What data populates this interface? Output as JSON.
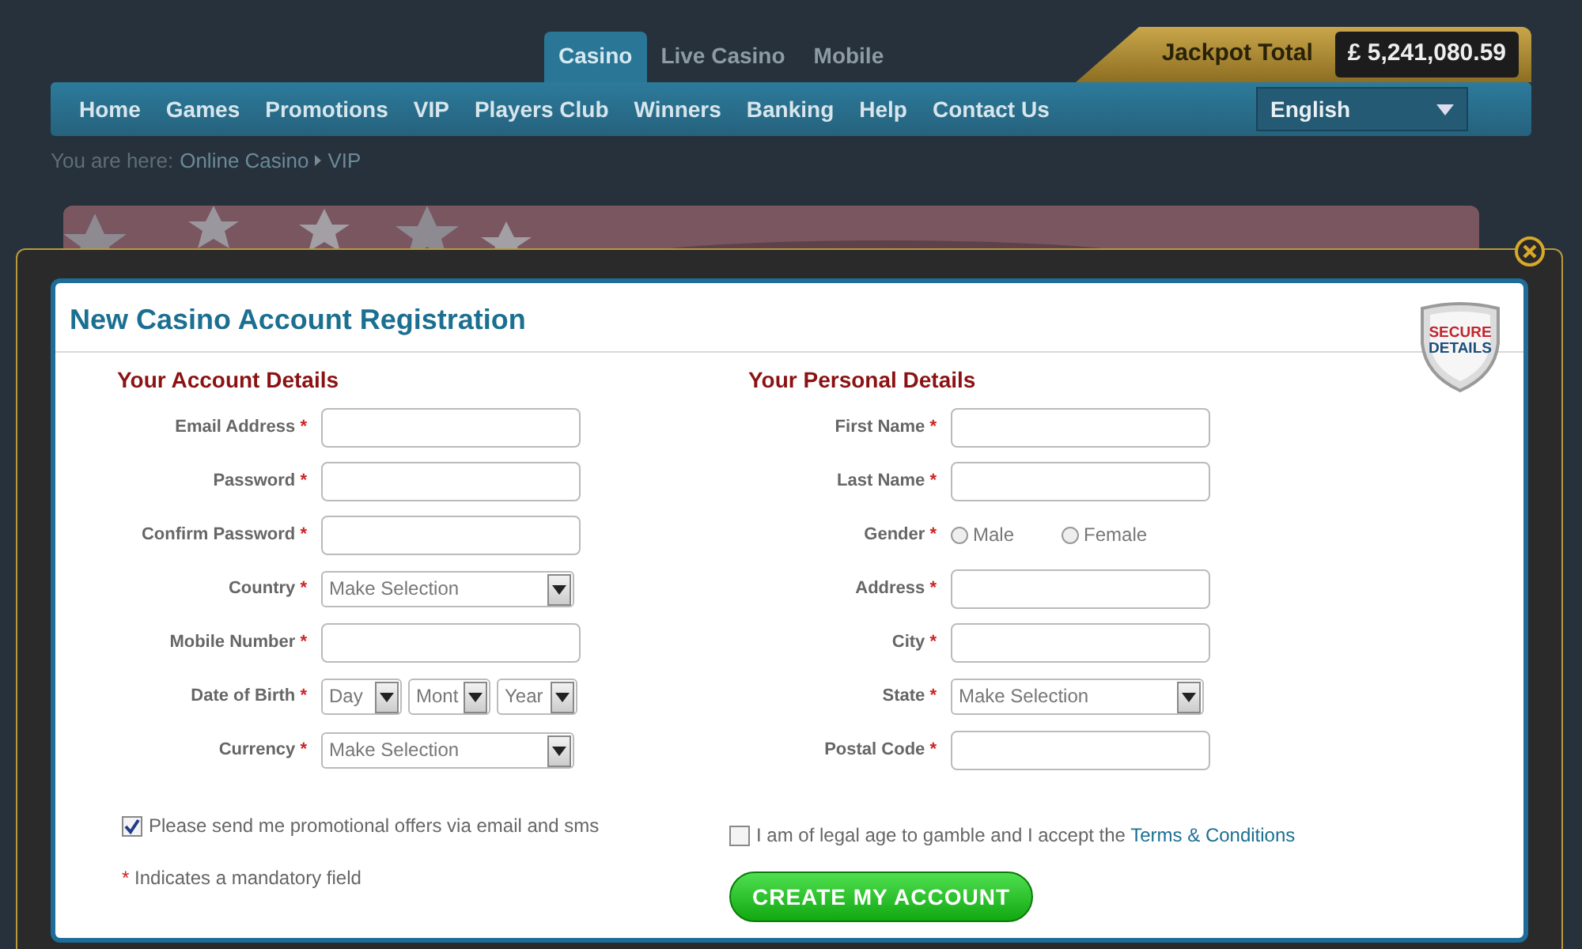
{
  "top_tabs": [
    {
      "label": "Casino",
      "selected": true
    },
    {
      "label": "Live Casino",
      "selected": false
    },
    {
      "label": "Mobile",
      "selected": false
    }
  ],
  "jackpot": {
    "label": "Jackpot Total",
    "amount": "£ 5,241,080.59"
  },
  "nav": {
    "items": [
      "Home",
      "Games",
      "Promotions",
      "VIP",
      "Players Club",
      "Winners",
      "Banking",
      "Help",
      "Contact Us"
    ],
    "language": "English"
  },
  "breadcrumb": {
    "prefix": "You are here:",
    "links": [
      "Online Casino",
      "VIP"
    ]
  },
  "modal": {
    "title": "New Casino Account Registration",
    "badge": [
      "SECURE",
      "DETAILS"
    ],
    "columns": [
      {
        "heading": "Your Account Details",
        "fields": [
          {
            "label": "Email Address",
            "mark": "*",
            "kind": "text"
          },
          {
            "label": "Password",
            "mark": "*",
            "kind": "text"
          },
          {
            "label": "Confirm Password",
            "mark": "*",
            "kind": "text"
          },
          {
            "label": "Country",
            "mark": "*",
            "kind": "select",
            "value": "Make Selection"
          },
          {
            "label": "Mobile Number",
            "mark": "*",
            "kind": "text"
          },
          {
            "label": "Date of Birth",
            "mark": "*",
            "kind": "date",
            "parts": [
              "Day",
              "Mont",
              "Year"
            ]
          },
          {
            "label": "Currency",
            "mark": "*",
            "kind": "select",
            "value": "Make Selection"
          }
        ]
      },
      {
        "heading": "Your Personal Details",
        "fields": [
          {
            "label": "First Name",
            "mark": "*",
            "kind": "text"
          },
          {
            "label": "Last Name",
            "mark": "*",
            "kind": "text"
          },
          {
            "label": "Gender",
            "mark": "*",
            "kind": "radio",
            "options": [
              {
                "label": "Male",
                "selected": false
              },
              {
                "label": "Female",
                "selected": false
              }
            ]
          },
          {
            "label": "Address",
            "mark": "*",
            "kind": "text"
          },
          {
            "label": "City",
            "mark": "*",
            "kind": "text"
          },
          {
            "label": "State",
            "mark": "*",
            "kind": "select",
            "value": "Make Selection"
          },
          {
            "label": "Postal Code",
            "mark": "*",
            "kind": "text"
          }
        ]
      }
    ],
    "promo": {
      "label": "Please send me promotional offers via email and sms",
      "checked": true
    },
    "note": {
      "mark": "*",
      "text": "Indicates a mandatory field"
    },
    "legal": {
      "text": "I am of legal age to gamble and I accept the",
      "link": "Terms & Conditions",
      "checked": false
    },
    "submit": "CREATE MY ACCOUNT"
  }
}
